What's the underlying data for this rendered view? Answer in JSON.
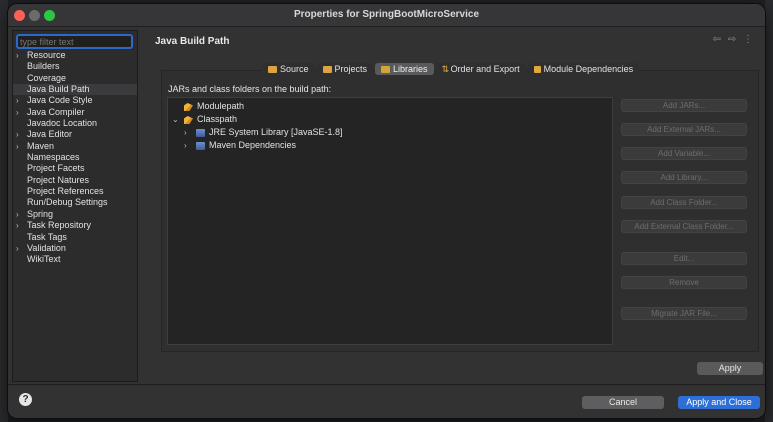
{
  "window": {
    "title": "Properties for SpringBootMicroService"
  },
  "sidebar": {
    "filter_placeholder": "type filter text",
    "items": [
      {
        "label": "Resource",
        "expandable": true
      },
      {
        "label": "Builders",
        "expandable": false
      },
      {
        "label": "Coverage",
        "expandable": false
      },
      {
        "label": "Java Build Path",
        "expandable": false,
        "selected": true
      },
      {
        "label": "Java Code Style",
        "expandable": true
      },
      {
        "label": "Java Compiler",
        "expandable": true
      },
      {
        "label": "Javadoc Location",
        "expandable": false
      },
      {
        "label": "Java Editor",
        "expandable": true
      },
      {
        "label": "Maven",
        "expandable": true
      },
      {
        "label": "Namespaces",
        "expandable": false
      },
      {
        "label": "Project Facets",
        "expandable": false
      },
      {
        "label": "Project Natures",
        "expandable": false
      },
      {
        "label": "Project References",
        "expandable": false
      },
      {
        "label": "Run/Debug Settings",
        "expandable": false
      },
      {
        "label": "Spring",
        "expandable": true
      },
      {
        "label": "Task Repository",
        "expandable": true
      },
      {
        "label": "Task Tags",
        "expandable": false
      },
      {
        "label": "Validation",
        "expandable": true
      },
      {
        "label": "WikiText",
        "expandable": false
      }
    ]
  },
  "page": {
    "title": "Java Build Path",
    "nav": {
      "back": "⇦",
      "forward": "⇨",
      "menu": "⋮"
    }
  },
  "tabs": [
    {
      "label": "Source",
      "icon": "source-folder-icon"
    },
    {
      "label": "Projects",
      "icon": "projects-icon"
    },
    {
      "label": "Libraries",
      "icon": "libraries-icon",
      "active": true
    },
    {
      "label": "Order and Export",
      "icon": "order-export-icon"
    },
    {
      "label": "Module Dependencies",
      "icon": "module-dependencies-icon"
    }
  ],
  "libraries": {
    "caption": "JARs and class folders on the build path:",
    "tree": [
      {
        "label": "Modulepath",
        "level": 0,
        "chevron": "",
        "icon": "modulepath-icon"
      },
      {
        "label": "Classpath",
        "level": 0,
        "chevron": "⌄",
        "icon": "classpath-icon"
      },
      {
        "label": "JRE System Library [JavaSE-1.8]",
        "level": 1,
        "chevron": "›",
        "icon": "jre-library-icon"
      },
      {
        "label": "Maven Dependencies",
        "level": 1,
        "chevron": "›",
        "icon": "maven-dependencies-icon"
      }
    ],
    "buttons": [
      {
        "label": "Add JARs...",
        "enabled": false
      },
      {
        "label": "Add External JARs...",
        "enabled": false
      },
      {
        "label": "Add Variable...",
        "enabled": false
      },
      {
        "label": "Add Library...",
        "enabled": false
      },
      {
        "label": "Add Class Folder...",
        "enabled": false
      },
      {
        "label": "Add External Class Folder...",
        "enabled": false
      },
      {
        "label": "Edit...",
        "enabled": false
      },
      {
        "label": "Remove",
        "enabled": false
      },
      {
        "label": "Migrate JAR File...",
        "enabled": false
      }
    ]
  },
  "apply_label": "Apply",
  "footer": {
    "help": "?",
    "cancel": "Cancel",
    "apply_close": "Apply and Close"
  }
}
